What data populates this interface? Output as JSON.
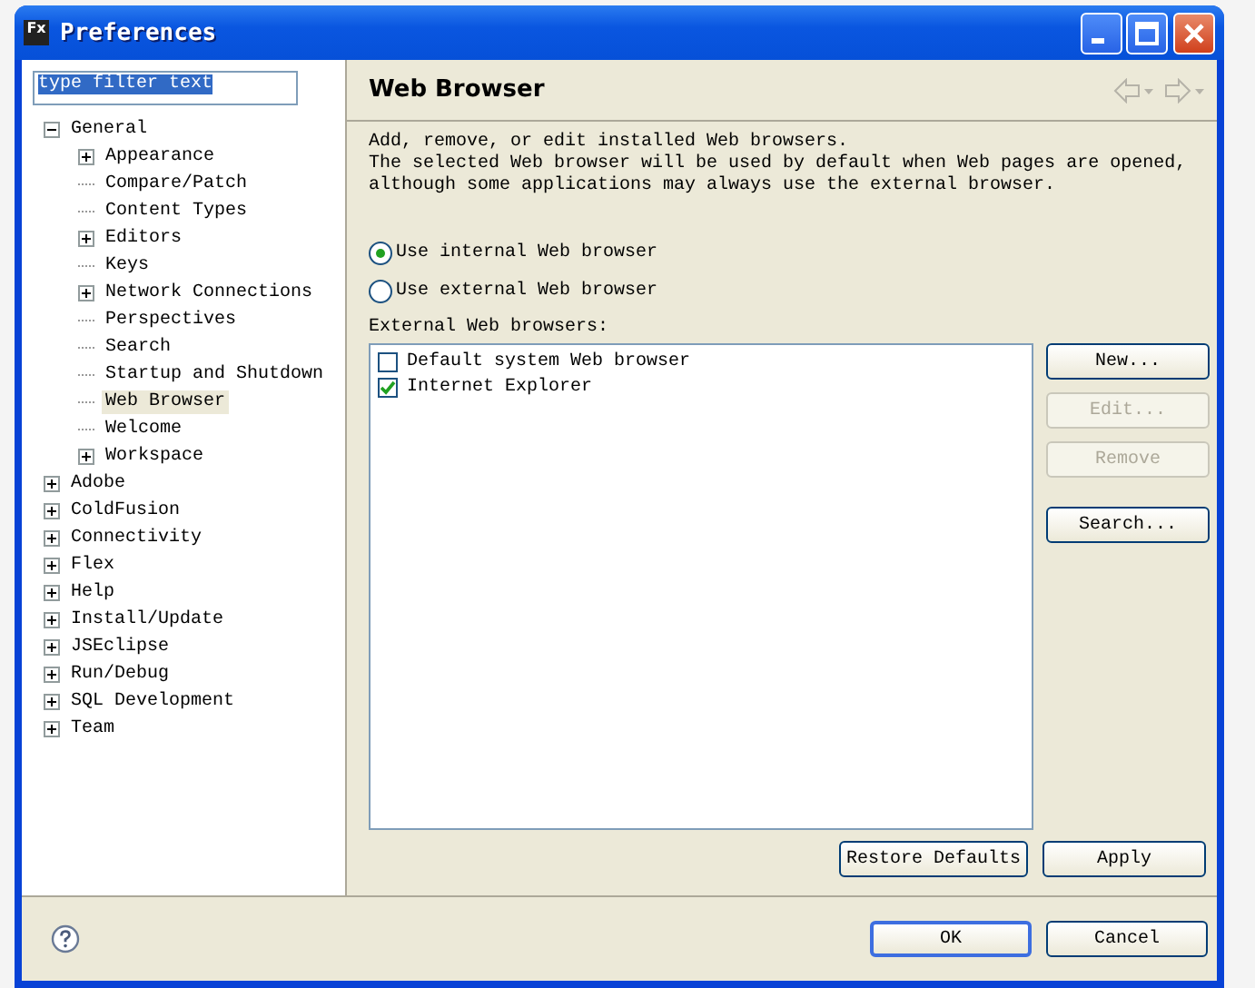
{
  "window": {
    "title": "Preferences",
    "app_icon": "Fx"
  },
  "filter": {
    "value": "type filter text"
  },
  "tree": [
    {
      "label": "General",
      "kind": "folder",
      "expanded": true,
      "selected": false,
      "children": [
        {
          "label": "Appearance",
          "kind": "folder",
          "expanded": false,
          "selected": false
        },
        {
          "label": "Compare/Patch",
          "kind": "leaf",
          "selected": false
        },
        {
          "label": "Content Types",
          "kind": "leaf",
          "selected": false
        },
        {
          "label": "Editors",
          "kind": "folder",
          "expanded": false,
          "selected": false
        },
        {
          "label": "Keys",
          "kind": "leaf",
          "selected": false
        },
        {
          "label": "Network Connections",
          "kind": "folder",
          "expanded": false,
          "selected": false
        },
        {
          "label": "Perspectives",
          "kind": "leaf",
          "selected": false
        },
        {
          "label": "Search",
          "kind": "leaf",
          "selected": false
        },
        {
          "label": "Startup and Shutdown",
          "kind": "leaf",
          "selected": false
        },
        {
          "label": "Web Browser",
          "kind": "leaf",
          "selected": true
        },
        {
          "label": "Welcome",
          "kind": "leaf",
          "selected": false
        },
        {
          "label": "Workspace",
          "kind": "folder",
          "expanded": false,
          "selected": false
        }
      ]
    },
    {
      "label": "Adobe",
      "kind": "folder",
      "expanded": false,
      "selected": false
    },
    {
      "label": "ColdFusion",
      "kind": "folder",
      "expanded": false,
      "selected": false
    },
    {
      "label": "Connectivity",
      "kind": "folder",
      "expanded": false,
      "selected": false
    },
    {
      "label": "Flex",
      "kind": "folder",
      "expanded": false,
      "selected": false
    },
    {
      "label": "Help",
      "kind": "folder",
      "expanded": false,
      "selected": false
    },
    {
      "label": "Install/Update",
      "kind": "folder",
      "expanded": false,
      "selected": false
    },
    {
      "label": "JSEclipse",
      "kind": "folder",
      "expanded": false,
      "selected": false
    },
    {
      "label": "Run/Debug",
      "kind": "folder",
      "expanded": false,
      "selected": false
    },
    {
      "label": "SQL Development",
      "kind": "folder",
      "expanded": false,
      "selected": false
    },
    {
      "label": "Team",
      "kind": "folder",
      "expanded": false,
      "selected": false
    }
  ],
  "page": {
    "title": "Web Browser",
    "description": [
      "Add, remove, or edit installed Web browsers.",
      "The selected Web browser will be used by default when Web pages are opened,",
      "although some applications may always use the external browser."
    ],
    "radios": [
      {
        "label": "Use internal Web browser",
        "selected": true
      },
      {
        "label": "Use external Web browser",
        "selected": false
      }
    ],
    "list_label": "External Web browsers:",
    "browsers": [
      {
        "label": "Default system Web browser",
        "checked": false
      },
      {
        "label": "Internet Explorer",
        "checked": true
      }
    ],
    "side_buttons": [
      {
        "label": "New...",
        "disabled": false
      },
      {
        "label": "Edit...",
        "disabled": true
      },
      {
        "label": "Remove",
        "disabled": true
      },
      {
        "label": "Search...",
        "disabled": false
      }
    ],
    "page_buttons": [
      "Restore Defaults",
      "Apply"
    ]
  },
  "dialog_buttons": [
    {
      "label": "OK",
      "default": true
    },
    {
      "label": "Cancel",
      "default": false
    }
  ]
}
